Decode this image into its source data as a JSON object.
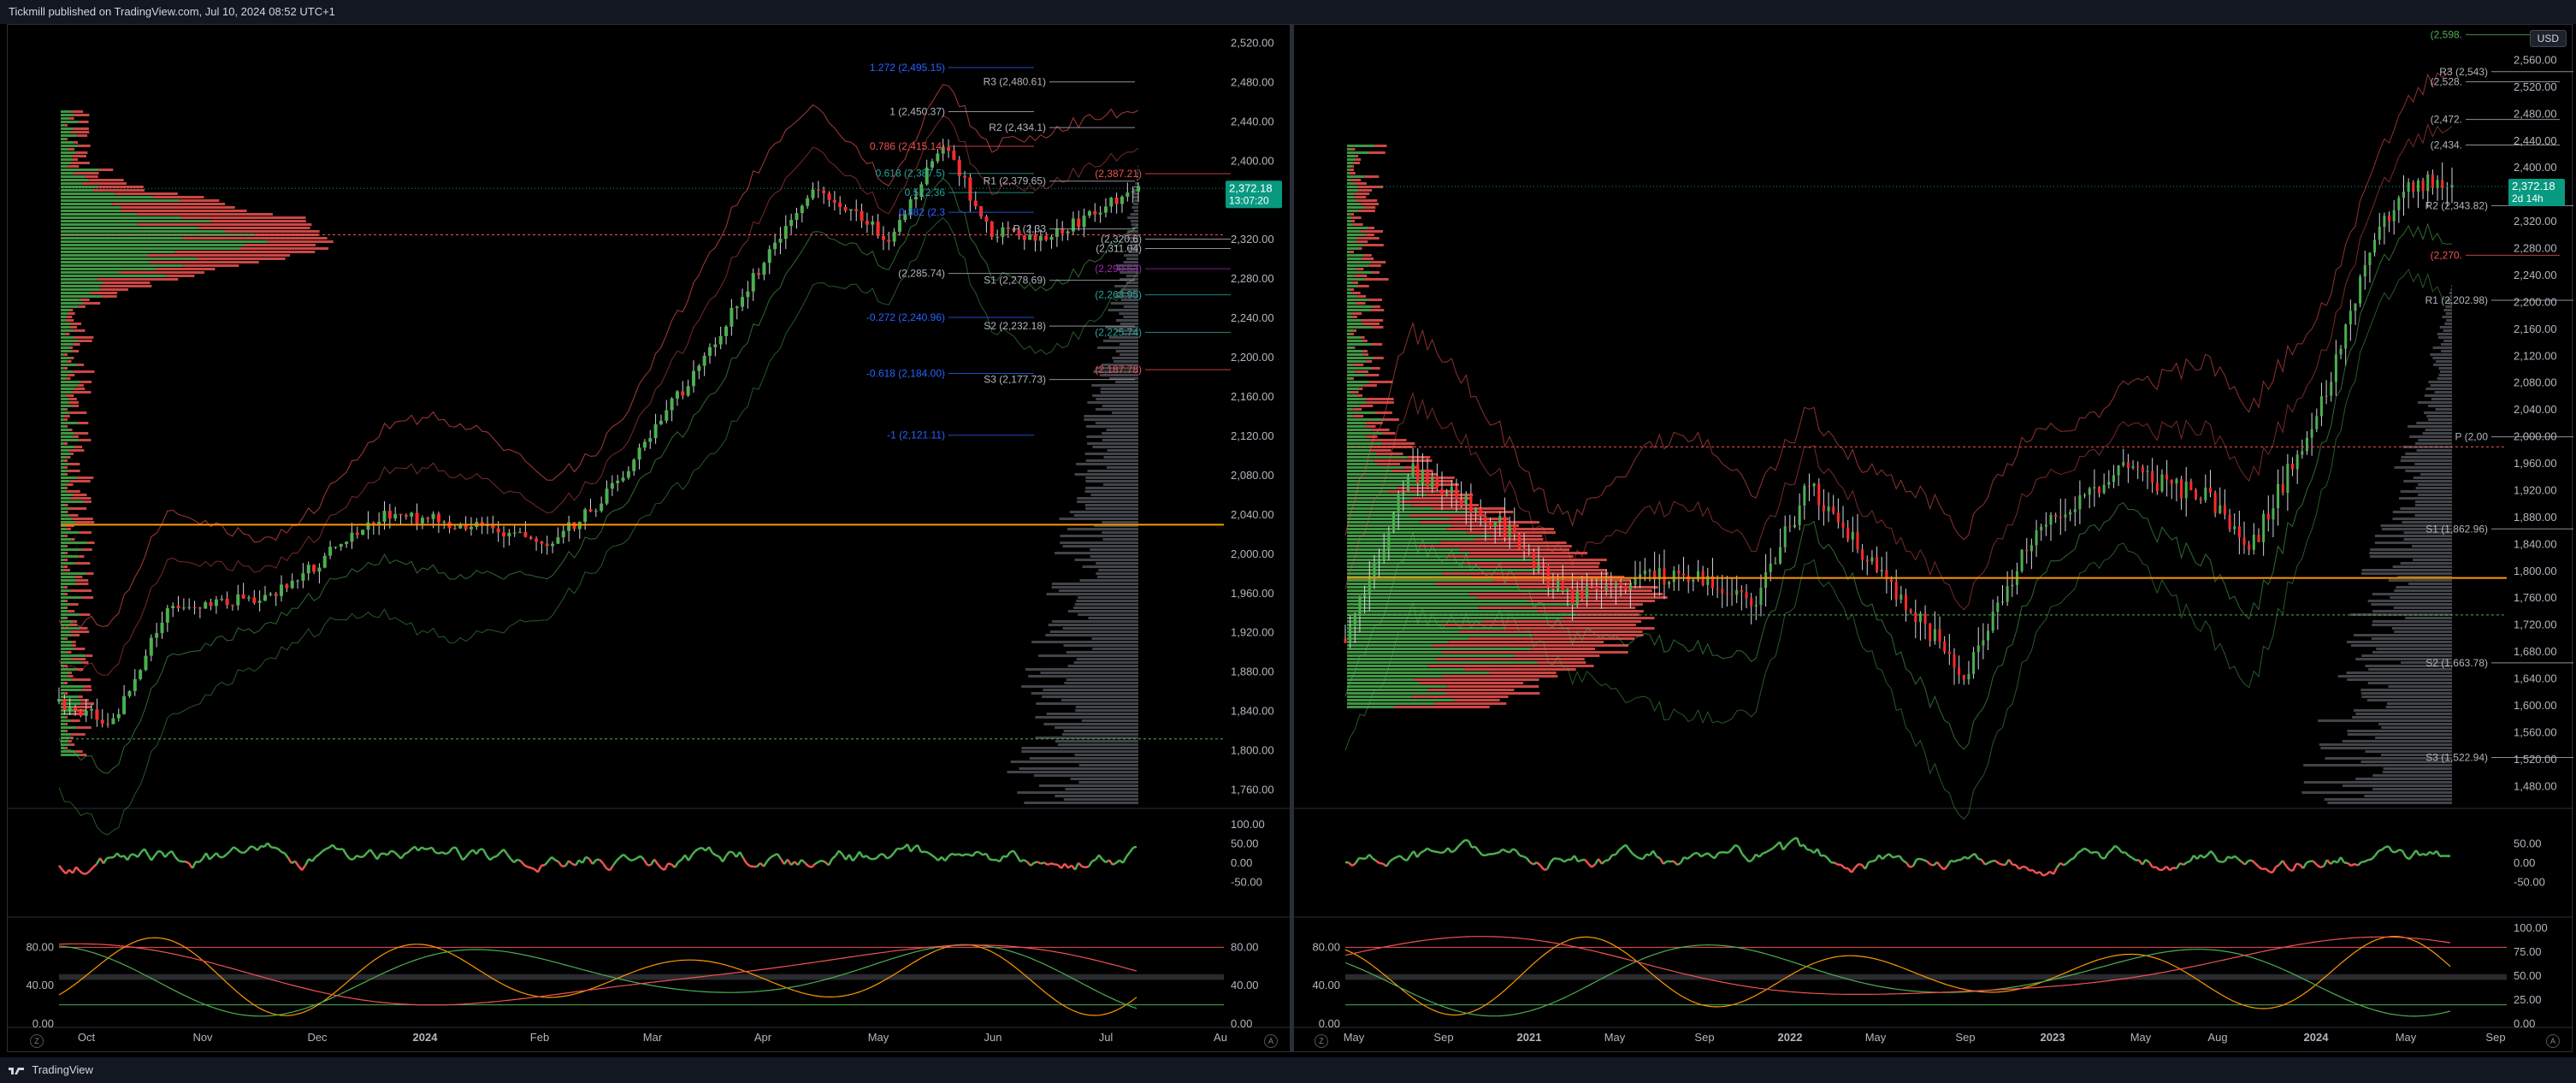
{
  "header": {
    "publisher": "Tickmill published on TradingView.com, Jul 10, 2024 08:52 UTC+1"
  },
  "footer": {
    "brand": "TradingView"
  },
  "colors": {
    "bull": "#26a69a",
    "bullGreen": "#4caf50",
    "bear": "#ef5350",
    "accentOrange": "#ff9800",
    "fib": "#2962ff",
    "price": "#089981"
  },
  "left": {
    "y_ticks": [
      "2,520.00",
      "2,480.00",
      "2,440.00",
      "2,400.00",
      "2,360.00",
      "2,320.00",
      "2,280.00",
      "2,240.00",
      "2,200.00",
      "2,160.00",
      "2,120.00",
      "2,080.00",
      "2,040.00",
      "2,000.00",
      "1,960.00",
      "1,920.00",
      "1,880.00",
      "1,840.00",
      "1,800.00",
      "1,760.00"
    ],
    "x_ticks": [
      "Oct",
      "Nov",
      "Dec",
      "2024",
      "Feb",
      "Mar",
      "Apr",
      "May",
      "Jun",
      "Jul",
      "Au"
    ],
    "price_label": "2,372.18",
    "timer_label": "13:07:20",
    "osc1_ticks": [
      "100.00",
      "50.00",
      "0.00",
      "-50.00"
    ],
    "osc2_ticks": [
      "80.00",
      "40.00",
      "0.00"
    ],
    "osc2_right_ticks": [
      "80.00",
      "40.00",
      "0.00"
    ],
    "levels": [
      {
        "label": "1.272 (2,495.15)",
        "color": "#2962ff",
        "value": 2495.15,
        "kind": "fib"
      },
      {
        "label": "R3 (2,480.61)",
        "color": "#b2b5be",
        "value": 2480.61,
        "kind": "piv"
      },
      {
        "label": "1 (2,450.37)",
        "color": "#b2b5be",
        "value": 2450.37,
        "kind": "fib"
      },
      {
        "label": "R2 (2,434.1)",
        "color": "#b2b5be",
        "value": 2434.1,
        "kind": "piv"
      },
      {
        "label": "0.786 (2,415.14)",
        "color": "#ef5350",
        "value": 2415.14,
        "kind": "fib"
      },
      {
        "label": "0.618 (2,387.5)",
        "color": "#26a69a",
        "value": 2387.5,
        "kind": "fib"
      },
      {
        "label": "(2,387.21)",
        "color": "#ef5350",
        "value": 2387.21,
        "kind": "cam"
      },
      {
        "label": "R1 (2,379.65)",
        "color": "#b2b5be",
        "value": 2379.65,
        "kind": "piv"
      },
      {
        "label": "0.5 (2,36",
        "color": "#26a69a",
        "value": 2368,
        "kind": "fib"
      },
      {
        "label": "0.382 (2,3",
        "color": "#2962ff",
        "value": 2348,
        "kind": "fib"
      },
      {
        "label": "P (2,33",
        "color": "#b2b5be",
        "value": 2331,
        "kind": "piv"
      },
      {
        "label": "(2,320.6)",
        "color": "#b2b5be",
        "value": 2320.6,
        "kind": "cam"
      },
      {
        "label": "(2,311.04)",
        "color": "#b2b5be",
        "value": 2311.04,
        "kind": "cam"
      },
      {
        "label": "(2,285.74)",
        "color": "#b2b5be",
        "value": 2285.74,
        "kind": "fib"
      },
      {
        "label": "(2,290.53)",
        "color": "#9c27b0",
        "value": 2290.53,
        "kind": "cam"
      },
      {
        "label": "S1 (2,278.69)",
        "color": "#b2b5be",
        "value": 2278.69,
        "kind": "piv"
      },
      {
        "label": "(2,263.95)",
        "color": "#26a69a",
        "value": 2263.95,
        "kind": "cam"
      },
      {
        "label": "-0.272 (2,240.96)",
        "color": "#2962ff",
        "value": 2240.96,
        "kind": "fib"
      },
      {
        "label": "S2 (2,232.18)",
        "color": "#b2b5be",
        "value": 2232.18,
        "kind": "piv"
      },
      {
        "label": "(2,225.74)",
        "color": "#26a69a",
        "value": 2225.74,
        "kind": "cam"
      },
      {
        "label": "-0.618 (2,184.00)",
        "color": "#2962ff",
        "value": 2184.0,
        "kind": "fib"
      },
      {
        "label": "(2,187.78)",
        "color": "#ef5350",
        "value": 2187.78,
        "kind": "cam"
      },
      {
        "label": "S3 (2,177.73)",
        "color": "#b2b5be",
        "value": 2177.73,
        "kind": "piv"
      },
      {
        "label": "-1 (2,121.11)",
        "color": "#2962ff",
        "value": 2121.11,
        "kind": "fib"
      }
    ]
  },
  "right": {
    "currency_button": "USD",
    "y_ticks": [
      "2,560.00",
      "2,520.00",
      "2,480.00",
      "2,440.00",
      "2,400.00",
      "2,360.00",
      "2,320.00",
      "2,280.00",
      "2,240.00",
      "2,200.00",
      "2,160.00",
      "2,120.00",
      "2,080.00",
      "2,040.00",
      "2,000.00",
      "1,960.00",
      "1,920.00",
      "1,880.00",
      "1,840.00",
      "1,800.00",
      "1,760.00",
      "1,720.00",
      "1,680.00",
      "1,640.00",
      "1,600.00",
      "1,560.00",
      "1,520.00",
      "1,480.00"
    ],
    "x_ticks": [
      "May",
      "Sep",
      "2021",
      "May",
      "Sep",
      "2022",
      "May",
      "Sep",
      "2023",
      "May",
      "Aug",
      "2024",
      "May",
      "Sep"
    ],
    "price_label": "2,372.18",
    "timer_label": "2d 14h",
    "osc1_ticks": [
      "50.00",
      "0.00",
      "-50.00"
    ],
    "osc2_left_ticks": [
      "80.00",
      "40.00",
      "0.00"
    ],
    "osc2_right_ticks": [
      "100.00",
      "75.00",
      "50.00",
      "25.00",
      "0.00"
    ],
    "levels": [
      {
        "label": "(2,598.",
        "color": "#4caf50",
        "value": 2598,
        "kind": "cam"
      },
      {
        "label": "R3 (2,543)",
        "color": "#b2b5be",
        "value": 2543,
        "kind": "piv"
      },
      {
        "label": "(2,528.",
        "color": "#b2b5be",
        "value": 2528,
        "kind": "cam"
      },
      {
        "label": "(2,472.",
        "color": "#b2b5be",
        "value": 2472,
        "kind": "cam"
      },
      {
        "label": "(2,434.",
        "color": "#b2b5be",
        "value": 2434,
        "kind": "cam"
      },
      {
        "label": "R2 (2,343.82)",
        "color": "#b2b5be",
        "value": 2343.82,
        "kind": "piv"
      },
      {
        "label": "(2,270.",
        "color": "#ef5350",
        "value": 2270,
        "kind": "cam"
      },
      {
        "label": "R1 (2,202.98)",
        "color": "#b2b5be",
        "value": 2202.98,
        "kind": "piv"
      },
      {
        "label": "P (2,00",
        "color": "#b2b5be",
        "value": 2000,
        "kind": "piv"
      },
      {
        "label": "S1 (1,862.96)",
        "color": "#b2b5be",
        "value": 1862.96,
        "kind": "piv"
      },
      {
        "label": "S2 (1,663.78)",
        "color": "#b2b5be",
        "value": 1663.78,
        "kind": "piv"
      },
      {
        "label": "S3 (1,522.94)",
        "color": "#b2b5be",
        "value": 1522.94,
        "kind": "piv"
      }
    ]
  }
}
